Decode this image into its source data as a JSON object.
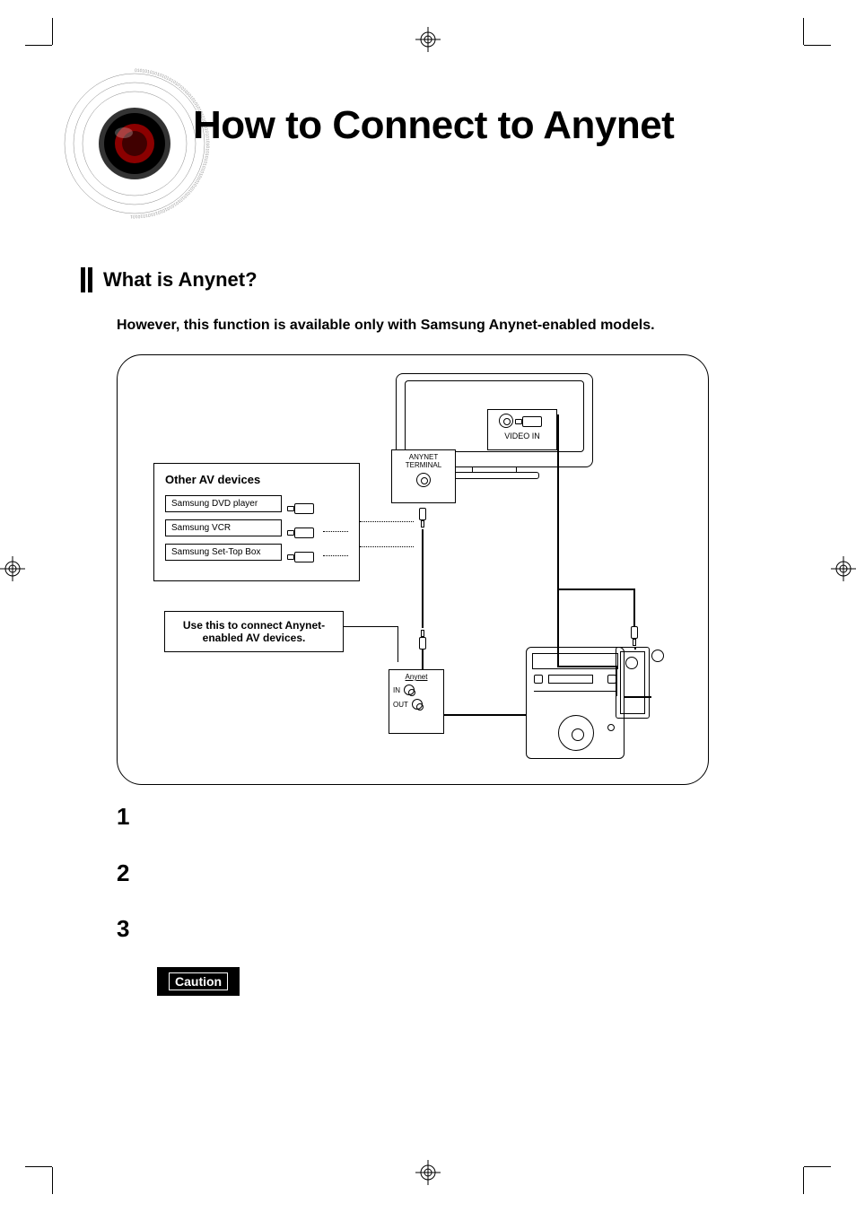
{
  "page": {
    "title": "How to Connect to Anynet"
  },
  "section": {
    "heading": "What is Anynet?",
    "note": "However, this function is available only with Samsung Anynet-enabled models."
  },
  "diagram": {
    "video_in_label": "VIDEO IN",
    "anynet_terminal_line1": "ANYNET",
    "anynet_terminal_line2": "TERMINAL",
    "av_box_title": "Other AV devices",
    "av_items": {
      "dvd": "Samsung DVD player",
      "vcr": "Samsung VCR",
      "stb": "Samsung Set-Top Box"
    },
    "callout_line1": "Use this to connect Anynet-",
    "callout_line2": "enabled AV devices.",
    "anynet_io_label": "Anynet",
    "anynet_in": "IN",
    "anynet_out": "OUT"
  },
  "steps": {
    "s1": "1",
    "s2": "2",
    "s3": "3"
  },
  "caution": {
    "label": "Caution"
  }
}
